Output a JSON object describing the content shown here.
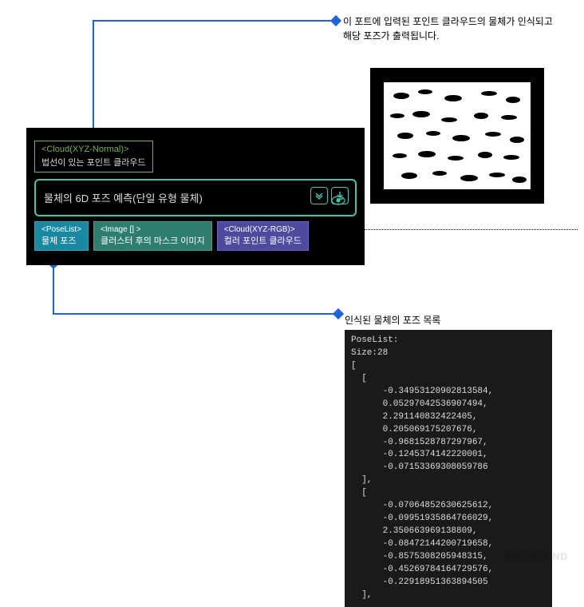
{
  "annotations": {
    "top": "이 포트에 입력된 포인트 클라우드의 물체가 인식되고 해당 포즈가 출력됩니다.",
    "middle": "인식된 물체의 포즈 목록"
  },
  "node": {
    "input": {
      "type": "<Cloud(XYZ-Normal)>",
      "label": "법선이 있는 포인트 클라우드"
    },
    "main": {
      "title": "물체의 6D 포즈 예측(단일 유형 물체)"
    },
    "outputs": {
      "pose": {
        "type": "<PoseList>",
        "label": "물체 포즈"
      },
      "image": {
        "type": "<Image [] >",
        "label": "클러스터 후의 마스크 이미지"
      },
      "cloud": {
        "type": "<Cloud(XYZ-RGB)>",
        "label": "컬러 포인트 클라우드"
      }
    }
  },
  "code": {
    "header": "PoseList:",
    "size_label": "Size:28",
    "open": "[",
    "item1_open": "  [",
    "v1_0": "      -0.34953120902813584,",
    "v1_1": "      0.05297042536907494,",
    "v1_2": "      2.291140832422405,",
    "v1_3": "      0.205069175207676,",
    "v1_4": "      -0.9681528787297967,",
    "v1_5": "      -0.1245374142220001,",
    "v1_6": "      -0.07153369308059786",
    "item1_close": "  ],",
    "item2_open": "  [",
    "v2_0": "      -0.07064852630625612,",
    "v2_1": "      -0.09951935864766029,",
    "v2_2": "      2.350663969138809,",
    "v2_3": "      -0.08472144200719658,",
    "v2_4": "      -0.8575308205948315,",
    "v2_5": "      -0.45269784164729576,",
    "v2_6": "      -0.22918951363894505",
    "item2_close": "  ],"
  },
  "watermark": "MECH MIND"
}
